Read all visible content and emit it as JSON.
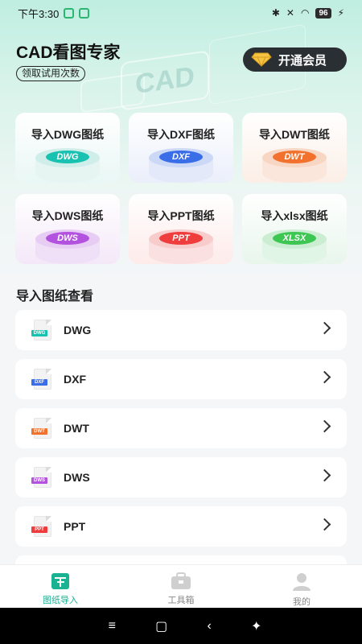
{
  "status_bar": {
    "time": "下午3:30",
    "battery": "96",
    "bluetooth": "✱",
    "signal_x": "✕",
    "wifi": "◠",
    "charging": "⚡"
  },
  "header": {
    "title": "CAD看图专家",
    "trial_label": "领取试用次数",
    "vip_label": "开通会员",
    "hero_deco_text": "CAD"
  },
  "import_cards": [
    {
      "label": "导入DWG图纸",
      "badge": "DWG",
      "colors": {
        "bg": "#e9f7f5",
        "top": "#19c2b0",
        "rim": "#cfeeea",
        "base": "#e6f4f2"
      }
    },
    {
      "label": "导入DXF图纸",
      "badge": "DXF",
      "colors": {
        "bg": "#ebeffb",
        "top": "#3a6ee8",
        "rim": "#cbd8f6",
        "base": "#e3e9f8"
      }
    },
    {
      "label": "导入DWT图纸",
      "badge": "DWT",
      "colors": {
        "bg": "#fbeee6",
        "top": "#f2712d",
        "rim": "#f8d6c4",
        "base": "#fae6da"
      }
    },
    {
      "label": "导入DWS图纸",
      "badge": "DWS",
      "colors": {
        "bg": "#f4e8f8",
        "top": "#b452e0",
        "rim": "#e7cdf3",
        "base": "#f0e0f7"
      }
    },
    {
      "label": "导入PPT图纸",
      "badge": "PPT",
      "colors": {
        "bg": "#fdebea",
        "top": "#ef3c3c",
        "rim": "#f9cccc",
        "base": "#fae0e0"
      }
    },
    {
      "label": "导入xlsx图纸",
      "badge": "XLSX",
      "colors": {
        "bg": "#e8f6ec",
        "top": "#3ec653",
        "rim": "#cbeed3",
        "base": "#e0f5e5"
      }
    }
  ],
  "section_title": "导入图纸查看",
  "file_rows": [
    {
      "label": "DWG",
      "tag": "DWG",
      "color": "#19c2b0"
    },
    {
      "label": "DXF",
      "tag": "DXF",
      "color": "#3a6ee8"
    },
    {
      "label": "DWT",
      "tag": "DWT",
      "color": "#f2712d"
    },
    {
      "label": "DWS",
      "tag": "DWS",
      "color": "#b452e0"
    },
    {
      "label": "PPT",
      "tag": "PPT",
      "color": "#ef3c3c"
    }
  ],
  "bottom_nav": [
    {
      "label": "图纸导入",
      "icon": "drawing-import-icon",
      "active": true
    },
    {
      "label": "工具箱",
      "icon": "toolbox-icon",
      "active": false
    },
    {
      "label": "我的",
      "icon": "profile-icon",
      "active": false
    }
  ],
  "system_nav": {
    "menu": "≡",
    "home": "▢",
    "back": "‹",
    "accessibility": "✦"
  },
  "accent_color": "#19b394"
}
